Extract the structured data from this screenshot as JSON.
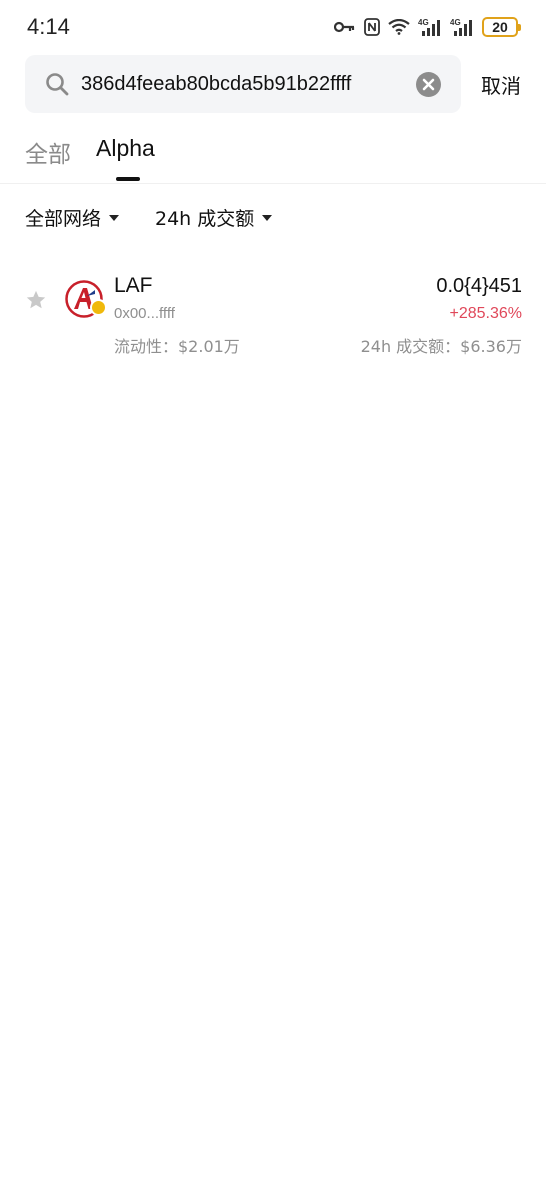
{
  "status_bar": {
    "time": "4:14",
    "network_1": "4G",
    "network_2": "4G",
    "battery": "20",
    "battery_color": "#e0a21a"
  },
  "search": {
    "value": "386d4feeab80bcda5b91b22ffff",
    "cancel_label": "取消"
  },
  "tabs": [
    {
      "label": "全部",
      "active": false
    },
    {
      "label": "Alpha",
      "active": true
    }
  ],
  "filters": {
    "network_label": "全部网络",
    "volume_label": "24h 成交额"
  },
  "tokens": [
    {
      "symbol": "LAF",
      "address": "0x00...ffff",
      "liquidity": "流动性：$2.01万",
      "price": "0.0{4}451",
      "change": "+285.36%",
      "volume": "24h 成交额：$6.36万",
      "change_color": "#e0485a",
      "logo_icon": "laf-logo-icon",
      "chain_icon": "bnb-chain-icon"
    }
  ]
}
